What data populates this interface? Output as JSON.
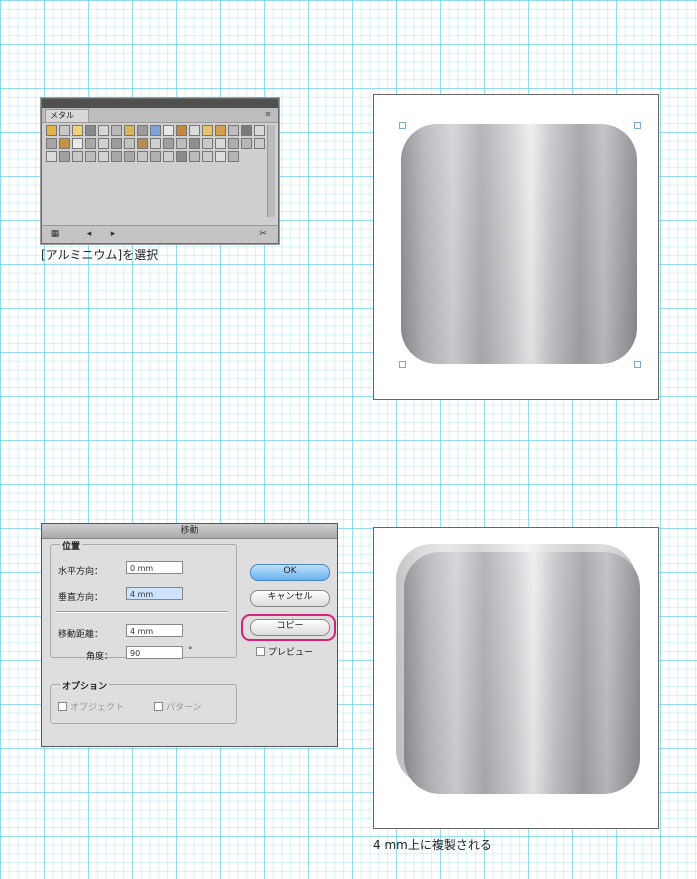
{
  "step1": {
    "panel": {
      "tab_label": "メタル",
      "menu_glyph": "≡",
      "swatch_colors": [
        "#e0b24a",
        "#c9c9c9",
        "#f4d27a",
        "#8a8a8a",
        "#d6d6d6",
        "#b8b8b8",
        "#d7b45a",
        "#9c9c9c",
        "#7da4d6",
        "#e8e8e8",
        "#c38a3d",
        "#dadada",
        "#eac267",
        "#d2a04e",
        "#bdbdbd",
        "#7a7a7a",
        "#d8d8d8",
        "#a5a5a5",
        "#c4933f",
        "#e9e9e9",
        "#a8a8a8",
        "#d1d1d1",
        "#9b9b9b",
        "#c3c3c3",
        "#b38c5a",
        "#cfcfcf",
        "#a0a0a0",
        "#bdbdbd",
        "#8f8f8f",
        "#c8c8c8",
        "#d9d9d9",
        "#aeaeae",
        "#b6b6b6",
        "#cacaca",
        "#dcdcdc",
        "#9f9f9f",
        "#c7c7c7",
        "#bcbcbc",
        "#d3d3d3",
        "#a9a9a9",
        "#a7a7a7",
        "#c6c6c6",
        "#b0b0b0",
        "#d0d0d0",
        "#8a8a8a",
        "#bbbbbb",
        "#cbcbcb",
        "#dedede",
        "#b4b4b4"
      ],
      "bottom_icons": [
        "library-icon",
        "prev-icon",
        "next-icon",
        "tool-icon"
      ]
    },
    "caption": "[アルミニウム]を選択"
  },
  "step2": {
    "dialog": {
      "title": "移動",
      "position_group": "位置",
      "horizontal_label": "水平方向：",
      "horizontal_value": "0 mm",
      "vertical_label": "垂直方向：",
      "vertical_value": "4 mm",
      "distance_label": "移動距離：",
      "distance_value": "4 mm",
      "angle_label": "角度：",
      "angle_value": "90",
      "angle_unit": "°",
      "options_group": "オプション",
      "option_object": "オブジェクト",
      "option_pattern": "パターン",
      "ok_label": "OK",
      "cancel_label": "キャンセル",
      "copy_label": "コピー",
      "preview_label": "プレビュー"
    },
    "caption": "4 mm上に複製される"
  },
  "colors": {
    "grid_line": "#5ac8e6",
    "highlight": "#d4237a",
    "ok_button": "#6ab2ee"
  }
}
